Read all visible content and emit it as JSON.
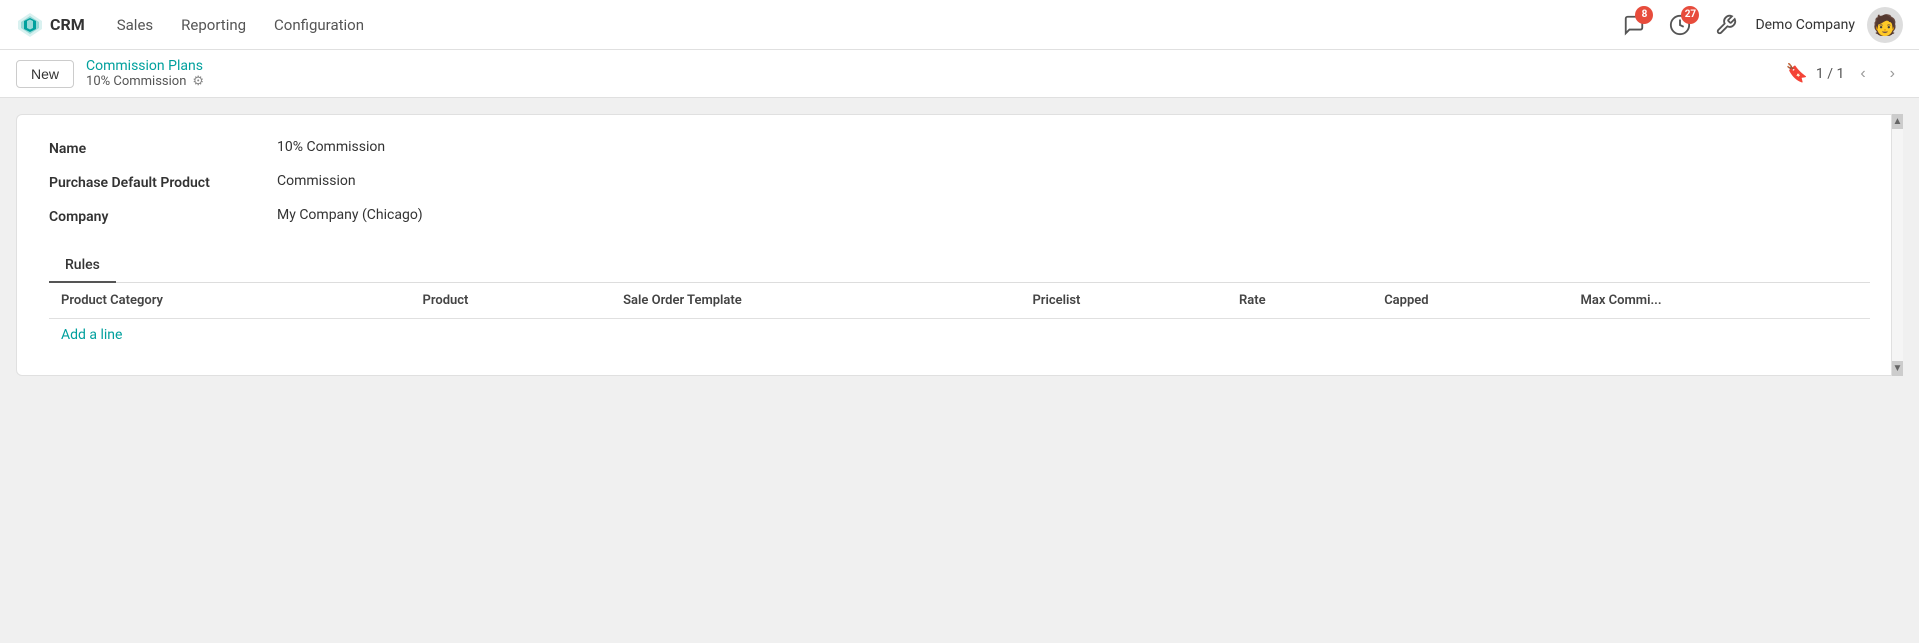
{
  "app": {
    "logo_text": "CRM",
    "nav_items": [
      "Sales",
      "Reporting",
      "Configuration"
    ],
    "notifications_count": "8",
    "activity_count": "27",
    "company_name": "Demo Company",
    "avatar_emoji": "🧑"
  },
  "actionbar": {
    "new_button": "New",
    "breadcrumb_parent": "Commission Plans",
    "breadcrumb_current": "10% Commission",
    "page_current": "1",
    "page_total": "1",
    "page_display": "1 / 1"
  },
  "form": {
    "name_label": "Name",
    "name_value": "10% Commission",
    "purchase_label": "Purchase Default Product",
    "purchase_value": "Commission",
    "company_label": "Company",
    "company_value": "My Company (Chicago)"
  },
  "tabs": [
    {
      "label": "Rules",
      "active": true
    }
  ],
  "table": {
    "columns": [
      "Product Category",
      "Product",
      "Sale Order Template",
      "Pricelist",
      "Rate",
      "Capped",
      "Max Commi..."
    ],
    "rows": [],
    "add_line": "Add a line"
  }
}
